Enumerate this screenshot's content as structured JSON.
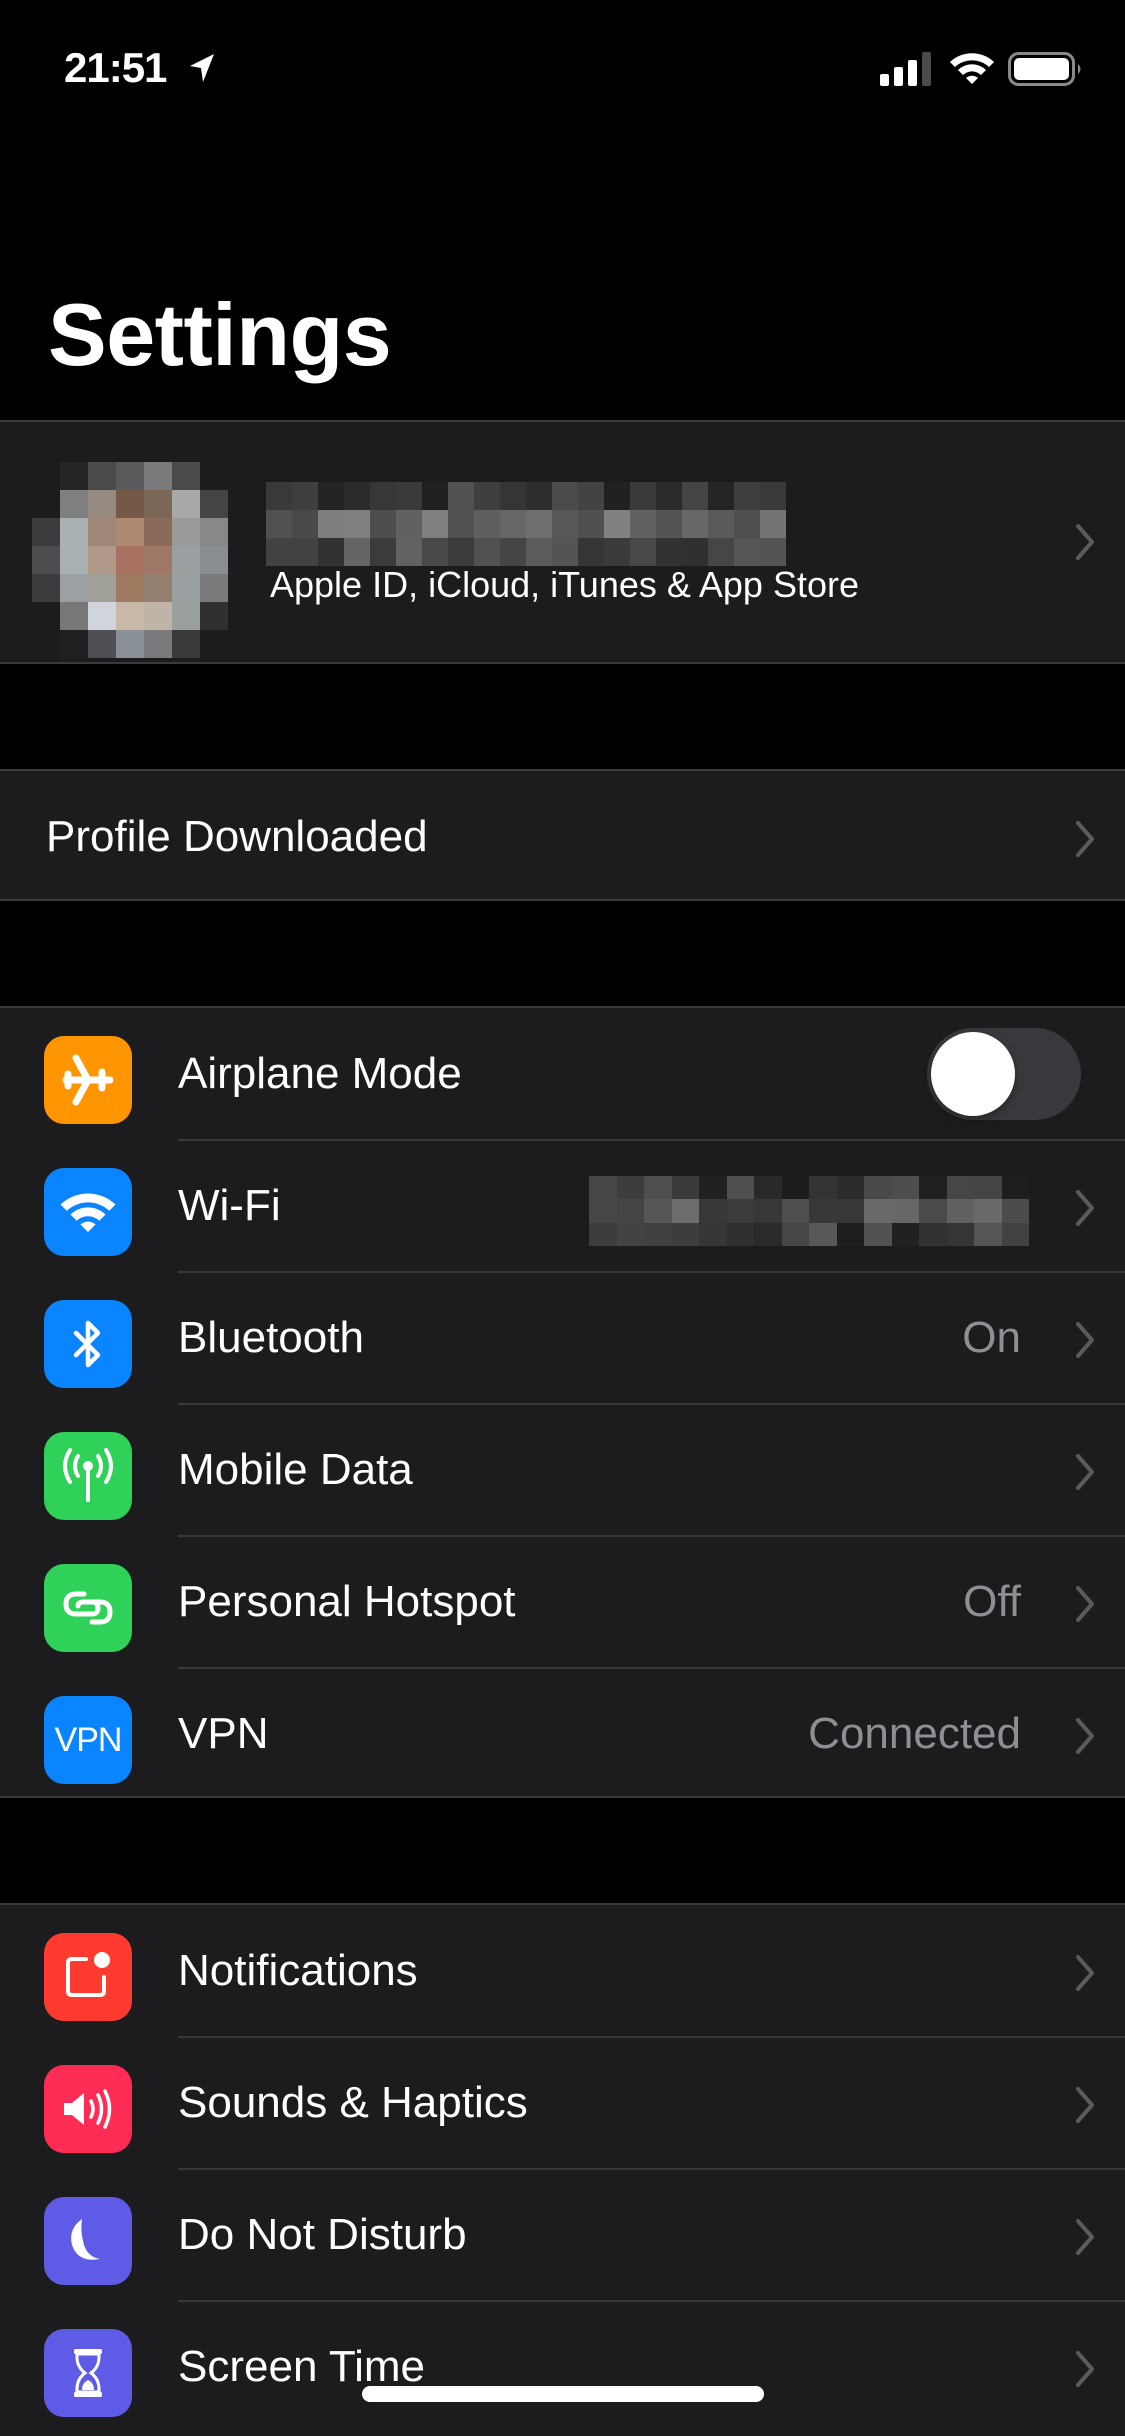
{
  "status_bar": {
    "time": "21:51",
    "location_active": true,
    "signal_bars_active": 3,
    "signal_bars_total": 4,
    "wifi": "connected",
    "battery_level_percent": 100
  },
  "header": {
    "title": "Settings"
  },
  "apple_id": {
    "name": "[redacted]",
    "subtitle": "Apple ID, iCloud, iTunes & App Store"
  },
  "profile": {
    "label": "Profile Downloaded"
  },
  "network": {
    "items": [
      {
        "label": "Airplane Mode",
        "icon": "airplane-icon",
        "color": "#ff9500",
        "control": "toggle",
        "toggle_on": false
      },
      {
        "label": "Wi-Fi",
        "icon": "wifi-icon",
        "color": "#0a84ff",
        "value": "[redacted]"
      },
      {
        "label": "Bluetooth",
        "icon": "bluetooth-icon",
        "color": "#0a84ff",
        "value": "On"
      },
      {
        "label": "Mobile Data",
        "icon": "antenna-icon",
        "color": "#30d158",
        "value": ""
      },
      {
        "label": "Personal Hotspot",
        "icon": "hotspot-icon",
        "color": "#30d158",
        "value": "Off"
      },
      {
        "label": "VPN",
        "icon": "vpn-icon",
        "icon_text": "VPN",
        "color": "#0a84ff",
        "value": "Connected"
      }
    ]
  },
  "notifications_group": {
    "items": [
      {
        "label": "Notifications",
        "icon": "notifications-icon",
        "color": "#ff3b30"
      },
      {
        "label": "Sounds & Haptics",
        "icon": "speaker-icon",
        "color": "#ff2d55"
      },
      {
        "label": "Do Not Disturb",
        "icon": "moon-icon",
        "color": "#5e5ce6"
      },
      {
        "label": "Screen Time",
        "icon": "hourglass-icon",
        "color": "#5e5ce6"
      }
    ]
  },
  "colors": {
    "background": "#000000",
    "cell": "#1c1c1e",
    "separator": "#38383a",
    "secondary_text": "#8e8e93",
    "chevron": "#5a5a5f"
  }
}
